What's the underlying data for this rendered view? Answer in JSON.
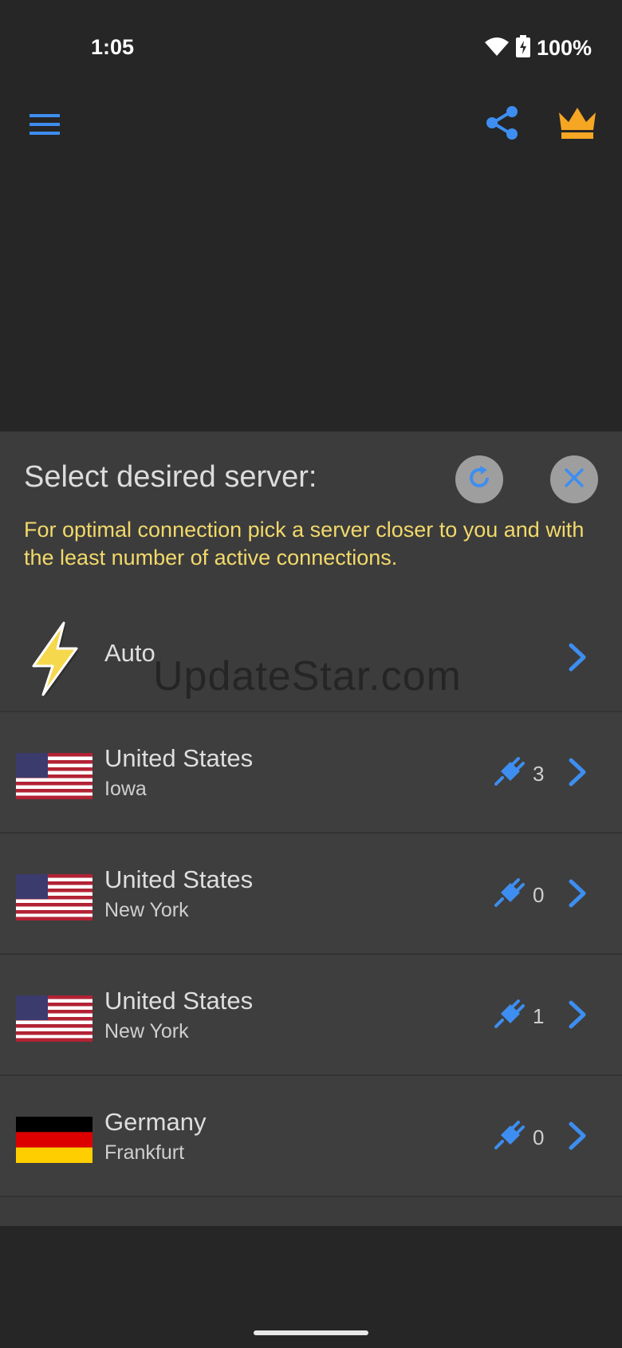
{
  "status_bar": {
    "time": "1:05",
    "battery": "100%",
    "icons": [
      "wifi-icon",
      "battery-icon"
    ]
  },
  "app_bar": {
    "icons": [
      "menu-icon",
      "share-icon",
      "crown-icon"
    ]
  },
  "server_picker": {
    "title": "Select desired server:",
    "hint": "For optimal connection pick a server closer to you and with the least number of active connections.",
    "auto_label": "Auto",
    "servers": [
      {
        "country": "United States",
        "city": "Iowa",
        "connections": "3",
        "flag": "us"
      },
      {
        "country": "United States",
        "city": "New York",
        "connections": "0",
        "flag": "us"
      },
      {
        "country": "United States",
        "city": "New York",
        "connections": "1",
        "flag": "us"
      },
      {
        "country": "Germany",
        "city": "Frankfurt",
        "connections": "0",
        "flag": "de"
      }
    ]
  },
  "watermark": "UpdateStar.com",
  "colors": {
    "background": "#262626",
    "sheet": "#3c3c3c",
    "accent": "#3d8ef0",
    "hint_text": "#f2d96a",
    "crown": "#f5a623"
  }
}
